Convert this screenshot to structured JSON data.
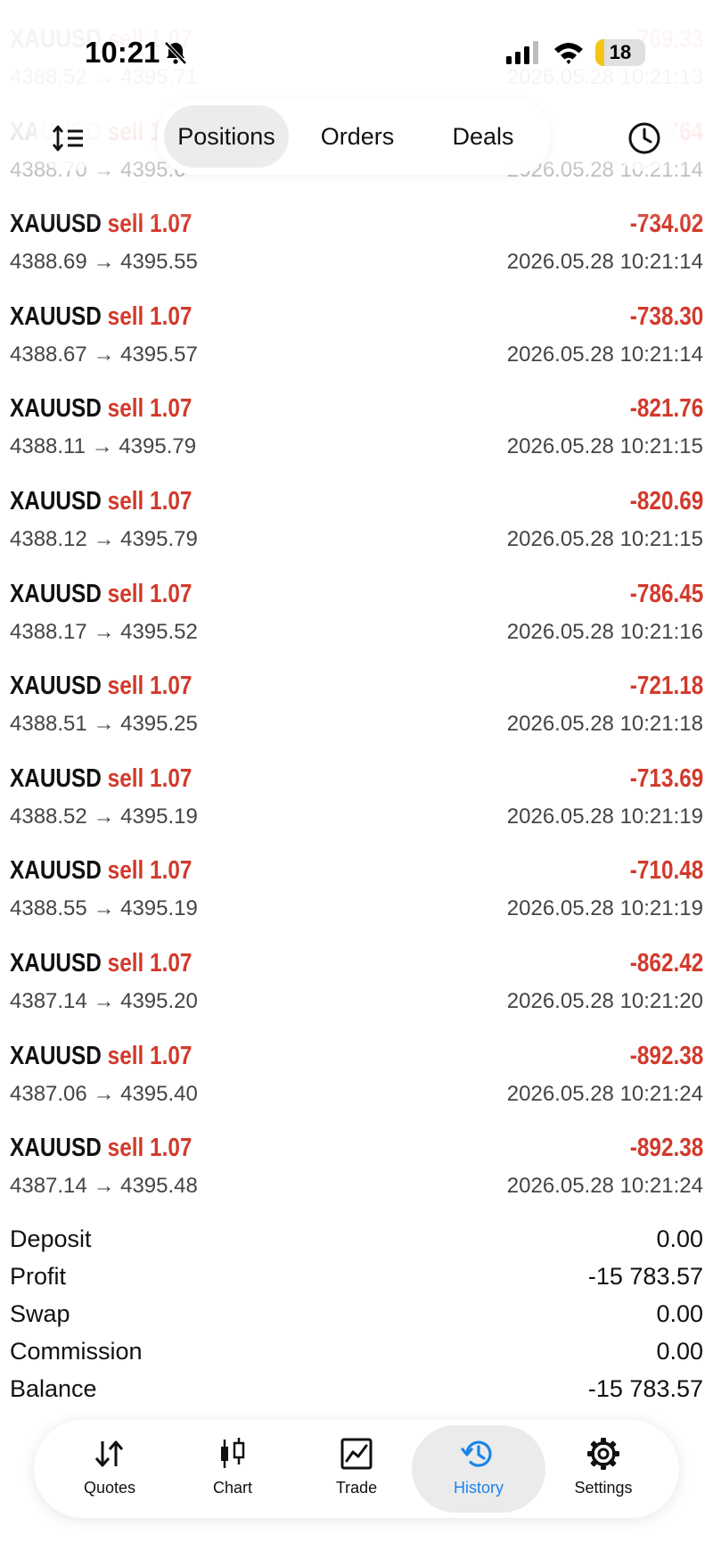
{
  "status_bar": {
    "time": "10:21",
    "battery_level": "18",
    "battery_fraction": 0.18
  },
  "header": {
    "tabs": [
      "Positions",
      "Orders",
      "Deals"
    ],
    "selected_tab": "Positions",
    "left_icon": "sort-icon",
    "right_icon": "clock-icon"
  },
  "deals": [
    {
      "symbol": "XAUUSD",
      "side": "sell",
      "volume": "1.07",
      "open": "4388.52",
      "close": "4395.71",
      "profit": "-769.33",
      "time": "2026.05.28 10:21:13"
    },
    {
      "symbol": "XAUUSD",
      "side": "sell",
      "volume": "1.07",
      "open": "4388.70",
      "close": "4395.6",
      "profit": "-764",
      "time": "2026.05.28 10:21:14"
    },
    {
      "symbol": "XAUUSD",
      "side": "sell",
      "volume": "1.07",
      "open": "4388.69",
      "close": "4395.55",
      "profit": "-734.02",
      "time": "2026.05.28 10:21:14"
    },
    {
      "symbol": "XAUUSD",
      "side": "sell",
      "volume": "1.07",
      "open": "4388.67",
      "close": "4395.57",
      "profit": "-738.30",
      "time": "2026.05.28 10:21:14"
    },
    {
      "symbol": "XAUUSD",
      "side": "sell",
      "volume": "1.07",
      "open": "4388.11",
      "close": "4395.79",
      "profit": "-821.76",
      "time": "2026.05.28 10:21:15"
    },
    {
      "symbol": "XAUUSD",
      "side": "sell",
      "volume": "1.07",
      "open": "4388.12",
      "close": "4395.79",
      "profit": "-820.69",
      "time": "2026.05.28 10:21:15"
    },
    {
      "symbol": "XAUUSD",
      "side": "sell",
      "volume": "1.07",
      "open": "4388.17",
      "close": "4395.52",
      "profit": "-786.45",
      "time": "2026.05.28 10:21:16"
    },
    {
      "symbol": "XAUUSD",
      "side": "sell",
      "volume": "1.07",
      "open": "4388.51",
      "close": "4395.25",
      "profit": "-721.18",
      "time": "2026.05.28 10:21:18"
    },
    {
      "symbol": "XAUUSD",
      "side": "sell",
      "volume": "1.07",
      "open": "4388.52",
      "close": "4395.19",
      "profit": "-713.69",
      "time": "2026.05.28 10:21:19"
    },
    {
      "symbol": "XAUUSD",
      "side": "sell",
      "volume": "1.07",
      "open": "4388.55",
      "close": "4395.19",
      "profit": "-710.48",
      "time": "2026.05.28 10:21:19"
    },
    {
      "symbol": "XAUUSD",
      "side": "sell",
      "volume": "1.07",
      "open": "4387.14",
      "close": "4395.20",
      "profit": "-862.42",
      "time": "2026.05.28 10:21:20"
    },
    {
      "symbol": "XAUUSD",
      "side": "sell",
      "volume": "1.07",
      "open": "4387.06",
      "close": "4395.40",
      "profit": "-892.38",
      "time": "2026.05.28 10:21:24"
    },
    {
      "symbol": "XAUUSD",
      "side": "sell",
      "volume": "1.07",
      "open": "4387.14",
      "close": "4395.48",
      "profit": "-892.38",
      "time": "2026.05.28 10:21:24"
    }
  ],
  "arrow": "→",
  "summary": [
    {
      "label": "Deposit",
      "value": "0.00"
    },
    {
      "label": "Profit",
      "value": "-15 783.57"
    },
    {
      "label": "Swap",
      "value": "0.00"
    },
    {
      "label": "Commission",
      "value": "0.00"
    },
    {
      "label": "Balance",
      "value": "-15 783.57"
    }
  ],
  "nav": {
    "items": [
      {
        "label": "Quotes",
        "icon": "quotes-icon"
      },
      {
        "label": "Chart",
        "icon": "chart-icon"
      },
      {
        "label": "Trade",
        "icon": "trade-icon"
      },
      {
        "label": "History",
        "icon": "history-icon"
      },
      {
        "label": "Settings",
        "icon": "settings-icon"
      }
    ],
    "active": "History"
  },
  "colors": {
    "loss": "#d23a2b",
    "accent": "#1a84e6",
    "battery": "#f5c518"
  }
}
